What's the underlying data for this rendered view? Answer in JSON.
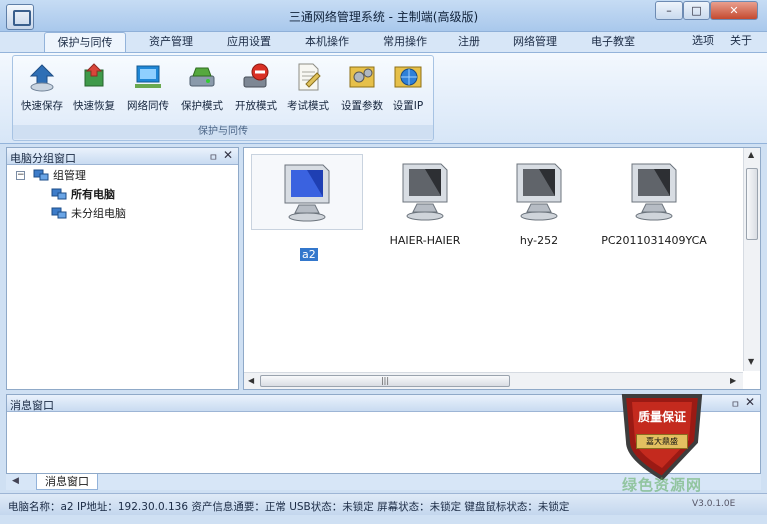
{
  "window": {
    "title": "三通网络管理系统 - 主制端(高级版)",
    "buttons": {
      "minimize": "–",
      "maximize": "□",
      "close": "✕"
    }
  },
  "tabs": [
    {
      "label": "保护与同传",
      "active": true
    },
    {
      "label": "资产管理"
    },
    {
      "label": "应用设置"
    },
    {
      "label": "本机操作"
    },
    {
      "label": "常用操作"
    },
    {
      "label": "注册"
    },
    {
      "label": "网络管理"
    },
    {
      "label": "电子教室"
    }
  ],
  "tab_options": "选项",
  "tab_about": "关于",
  "ribbon": {
    "group_label": "保护与同传",
    "buttons": [
      {
        "label": "快速保存",
        "icon": "quick-save-icon"
      },
      {
        "label": "快速恢复",
        "icon": "quick-restore-icon"
      },
      {
        "label": "网络同传",
        "icon": "network-sync-icon"
      },
      {
        "label": "保护模式",
        "icon": "protect-mode-icon"
      },
      {
        "label": "开放模式",
        "icon": "open-mode-icon"
      },
      {
        "label": "考试模式",
        "icon": "exam-mode-icon"
      },
      {
        "label": "设置参数",
        "icon": "settings-icon"
      },
      {
        "label": "设置IP",
        "icon": "set-ip-icon"
      }
    ]
  },
  "left_panel": {
    "title": "电脑分组窗口",
    "pin": "ㅁ",
    "close": "✕",
    "tree": [
      {
        "label": "组管理",
        "expander": "−",
        "level": 0
      },
      {
        "label": "所有电脑",
        "level": 1,
        "bold": true
      },
      {
        "label": "未分组电脑",
        "level": 1
      }
    ]
  },
  "computers": [
    {
      "name": "a2",
      "selected": true
    },
    {
      "name": "HAIER-HAIER"
    },
    {
      "name": "hy-252"
    },
    {
      "name": "PC2011031409YCA"
    }
  ],
  "message_panel": {
    "title": "消息窗口",
    "pin": "ㅁ",
    "close": "✕",
    "tab": "消息窗口"
  },
  "badge": {
    "title": "质量保证",
    "subtitle": "嘉大鼎盛"
  },
  "status_bar": {
    "text": "电脑名称：a2  IP地址：192.30.0.136  资产信息通要：正常  USB状态：未锁定  屏幕状态：未锁定  键盘鼠标状态：未锁定",
    "version": "V3.0.1.0E"
  },
  "watermark": "绿色资源网",
  "colors": {
    "accent": "#3377cc",
    "ribbon_bg": "#d7e6f7",
    "frame": "#cfe0f3"
  }
}
